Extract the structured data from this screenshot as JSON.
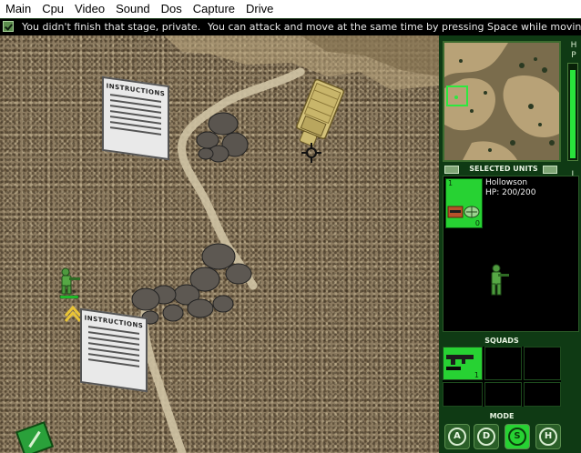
{
  "menu": [
    "Main",
    "Cpu",
    "Video",
    "Sound",
    "Dos",
    "Capture",
    "Drive"
  ],
  "messages": {
    "left": "You didn't finish that stage, private.",
    "right": "You can attack and move at the same time by pressing Space while moving."
  },
  "map": {
    "signs": [
      {
        "label": "INSTRUCTIONS"
      },
      {
        "label": "INSTRUCTIONS"
      }
    ]
  },
  "panel": {
    "hp_label": "H P",
    "hp_fraction": 0.95,
    "ltmg_label": "L T M G",
    "selected_units_header": "SELECTED UNITS",
    "unit": {
      "slot_number": "1",
      "slot_count": "0",
      "name": "Hollowson",
      "hp": "HP: 200/200"
    },
    "squads_header": "SQUADS",
    "squad_slot_count": "1",
    "mode_header": "MODE",
    "modes": [
      {
        "key": "A",
        "active": false
      },
      {
        "key": "D",
        "active": false
      },
      {
        "key": "S",
        "active": true
      },
      {
        "key": "H",
        "active": false
      }
    ]
  },
  "colors": {
    "panel_bg": "#0f3a14",
    "accent_green": "#27d233",
    "truck": "#d4c27a"
  }
}
